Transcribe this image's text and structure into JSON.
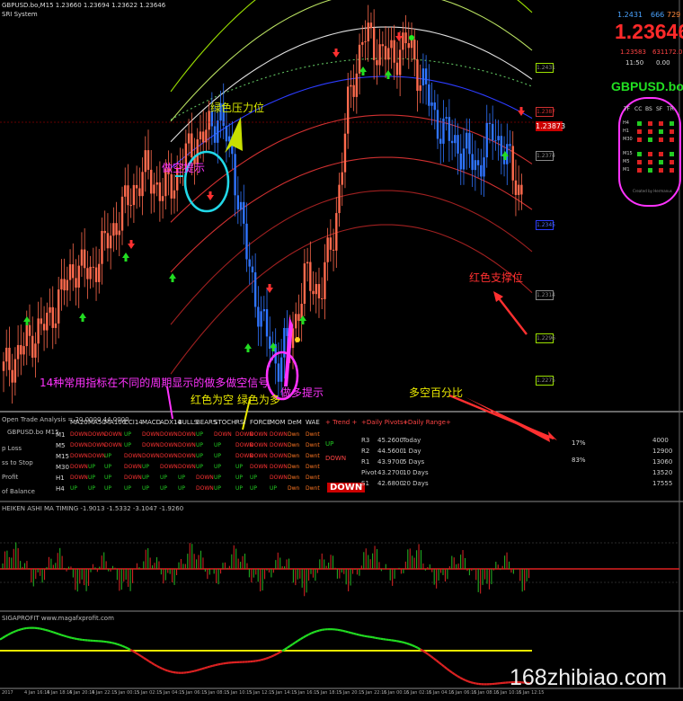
{
  "window": {
    "title": "GBPUSD.bo,M15 1.23660 1.23694 1.23622 1.23646",
    "subtitle": "SRI System"
  },
  "price_panel": {
    "top_left": "1.2431",
    "top_mid": "666",
    "top_right": "729",
    "price": "1.23646",
    "low_left": "1.23583",
    "low_right": "631172.0",
    "time_left": "11:50",
    "time_right": "0.00"
  },
  "symbol": "GBPUSD.bo",
  "trend_grid": {
    "headers": [
      "TF",
      "CC",
      "BS",
      "SF",
      "TR"
    ],
    "rows": [
      "H4",
      "H1",
      "M30",
      "M15",
      "M5",
      "M1"
    ],
    "footer": "Created by Hermanus"
  },
  "price_labels": {
    "top": "1.2431",
    "red_line": "1.2387",
    "current": "1.23873",
    "l3": "1.2374",
    "l4": "1.2345",
    "l5": "1.2314",
    "l6": "1.2296",
    "l7": "1.2275"
  },
  "annotations": {
    "red_resistance": "绿色压力位",
    "short_hint": "做空提示",
    "red_support": "红色支撑位",
    "indicator_note": "14种常用指标在不同的周期显示的做多做空信号",
    "color_note": "红色为空 绿色为多",
    "long_hint": "做多提示",
    "long_short_pct": "多空百分比"
  },
  "analysis": {
    "title": "Open Trade Analysis = 20.0000 44.0000",
    "symbol_line": "GBPUSD.bo M15",
    "left_labels": [
      "p Loss",
      "ss to Stop",
      "Profit",
      "of Balance"
    ],
    "columns": [
      "MA20",
      "MA50",
      "MA100",
      "CCI14",
      "MACD",
      "ADX14",
      "BULLS",
      "BEARS",
      "STOCH",
      "RSI",
      "FORCE",
      "MOM",
      "DeM",
      "WAE"
    ],
    "timeframes": [
      "M1",
      "M5",
      "M15",
      "M30",
      "H1",
      "H4"
    ],
    "signals": [
      [
        "DOWN",
        "DOWN",
        "DOWN",
        "UP",
        "DOWN",
        "DOWN",
        "DOWN",
        "UP",
        "DOWN",
        "DOWN",
        "DOWN",
        "DOWN",
        "Dwn",
        "Dwnt"
      ],
      [
        "DOWN",
        "DOWN",
        "DOWN",
        "UP",
        "DOWN",
        "DOWN",
        "DOWN",
        "UP",
        "UP",
        "DOWN",
        "DOWN",
        "DOWN",
        "Dwn",
        "Dwnt"
      ],
      [
        "DOWN",
        "DOWN",
        "UP",
        "DOWN",
        "DOWN",
        "DOWN",
        "DOWN",
        "UP",
        "UP",
        "DOWN",
        "DOWN",
        "DOWN",
        "Dwn",
        "Dwnt"
      ],
      [
        "DOWN",
        "UP",
        "UP",
        "DOWN",
        "UP",
        "DOWN",
        "DOWN",
        "UP",
        "UP",
        "UP",
        "DOWN",
        "DOWN",
        "Dwn",
        "Dwnt"
      ],
      [
        "DOWN",
        "UP",
        "UP",
        "DOWN",
        "UP",
        "UP",
        "UP",
        "DOWN",
        "UP",
        "UP",
        "UP",
        "DOWN",
        "Dwn",
        "Dwnt"
      ],
      [
        "UP",
        "UP",
        "UP",
        "UP",
        "UP",
        "UP",
        "UP",
        "DOWN",
        "UP",
        "UP",
        "UP",
        "UP",
        "Dwn",
        "Dwnt"
      ]
    ],
    "trend_title": "+ Trend +",
    "trend_up": "UP",
    "trend_down": "DOWN",
    "trend_main": "DOWN",
    "pivots_title": "+Daily Pivots+",
    "pivots": [
      {
        "label": "R3",
        "value": "45.2600"
      },
      {
        "label": "R2",
        "value": "44.5600"
      },
      {
        "label": "R1",
        "value": "43.9700"
      },
      {
        "label": "Pivot",
        "value": "43.2700"
      },
      {
        "label": "S1",
        "value": "42.6800"
      }
    ],
    "range_title": "+Daily Range+",
    "ranges": [
      {
        "label": "Today",
        "value": "4000"
      },
      {
        "label": "1 Day",
        "value": "12900"
      },
      {
        "label": "5 Days",
        "value": "13060"
      },
      {
        "label": "10 Days",
        "value": "13520"
      },
      {
        "label": "20 Days",
        "value": "17555"
      }
    ],
    "pct_up": "17%",
    "pct_down": "83%"
  },
  "osc1": {
    "title": "HEIKEN ASHI MA TIMING -1.9013 -1.5332 -3.1047 -1.9260"
  },
  "osc2": {
    "title": "SIGAPROFIT www.magafxprofit.com"
  },
  "watermark": "168zhibiao.com",
  "time_axis": [
    "2017",
    "4 Jan 16:15",
    "4 Jan 18:15",
    "4 Jan 20:15",
    "4 Jan 22:15",
    "5 Jan 00:15",
    "5 Jan 02:15",
    "5 Jan 04:15",
    "5 Jan 06:15",
    "5 Jan 08:15",
    "5 Jan 10:15",
    "5 Jan 12:15",
    "5 Jan 14:15",
    "5 Jan 16:15",
    "5 Jan 18:15",
    "5 Jan 20:15",
    "5 Jan 22:15",
    "6 Jan 00:15",
    "6 Jan 02:15",
    "6 Jan 04:15",
    "6 Jan 06:15",
    "6 Jan 08:15",
    "6 Jan 10:15",
    "6 Jan 12:15"
  ],
  "chart_data": {
    "type": "line",
    "x_unit": "bar index (M15)",
    "series": [
      {
        "values": [
          1.2285,
          1.2292,
          1.23,
          1.2305,
          1.2318,
          1.233,
          1.2326,
          1.2338,
          1.235,
          1.2362,
          1.237,
          1.236,
          1.2368,
          1.238,
          1.2385,
          1.2395,
          1.2372,
          1.233,
          1.2305,
          1.2288,
          1.23,
          1.2325,
          1.2318,
          1.2345,
          1.24,
          1.2428,
          1.2422,
          1.2418,
          1.2425,
          1.241,
          1.2392,
          1.2384,
          1.2378,
          1.2372,
          1.2388,
          1.2375,
          1.236
        ]
      }
    ],
    "ylim": [
      1.227,
      1.2435
    ]
  },
  "colors": {
    "bull_candle": "#ff6a4d",
    "bear_candle": "#2f74ff",
    "band_green": "#9be000",
    "band_blue": "#2c3cff",
    "band_red": "#d03030",
    "annot_cyan": "#22d8e8",
    "annot_magenta": "#ff33ff",
    "annot_yellow": "#e8e800",
    "annot_red": "#ff3030"
  }
}
